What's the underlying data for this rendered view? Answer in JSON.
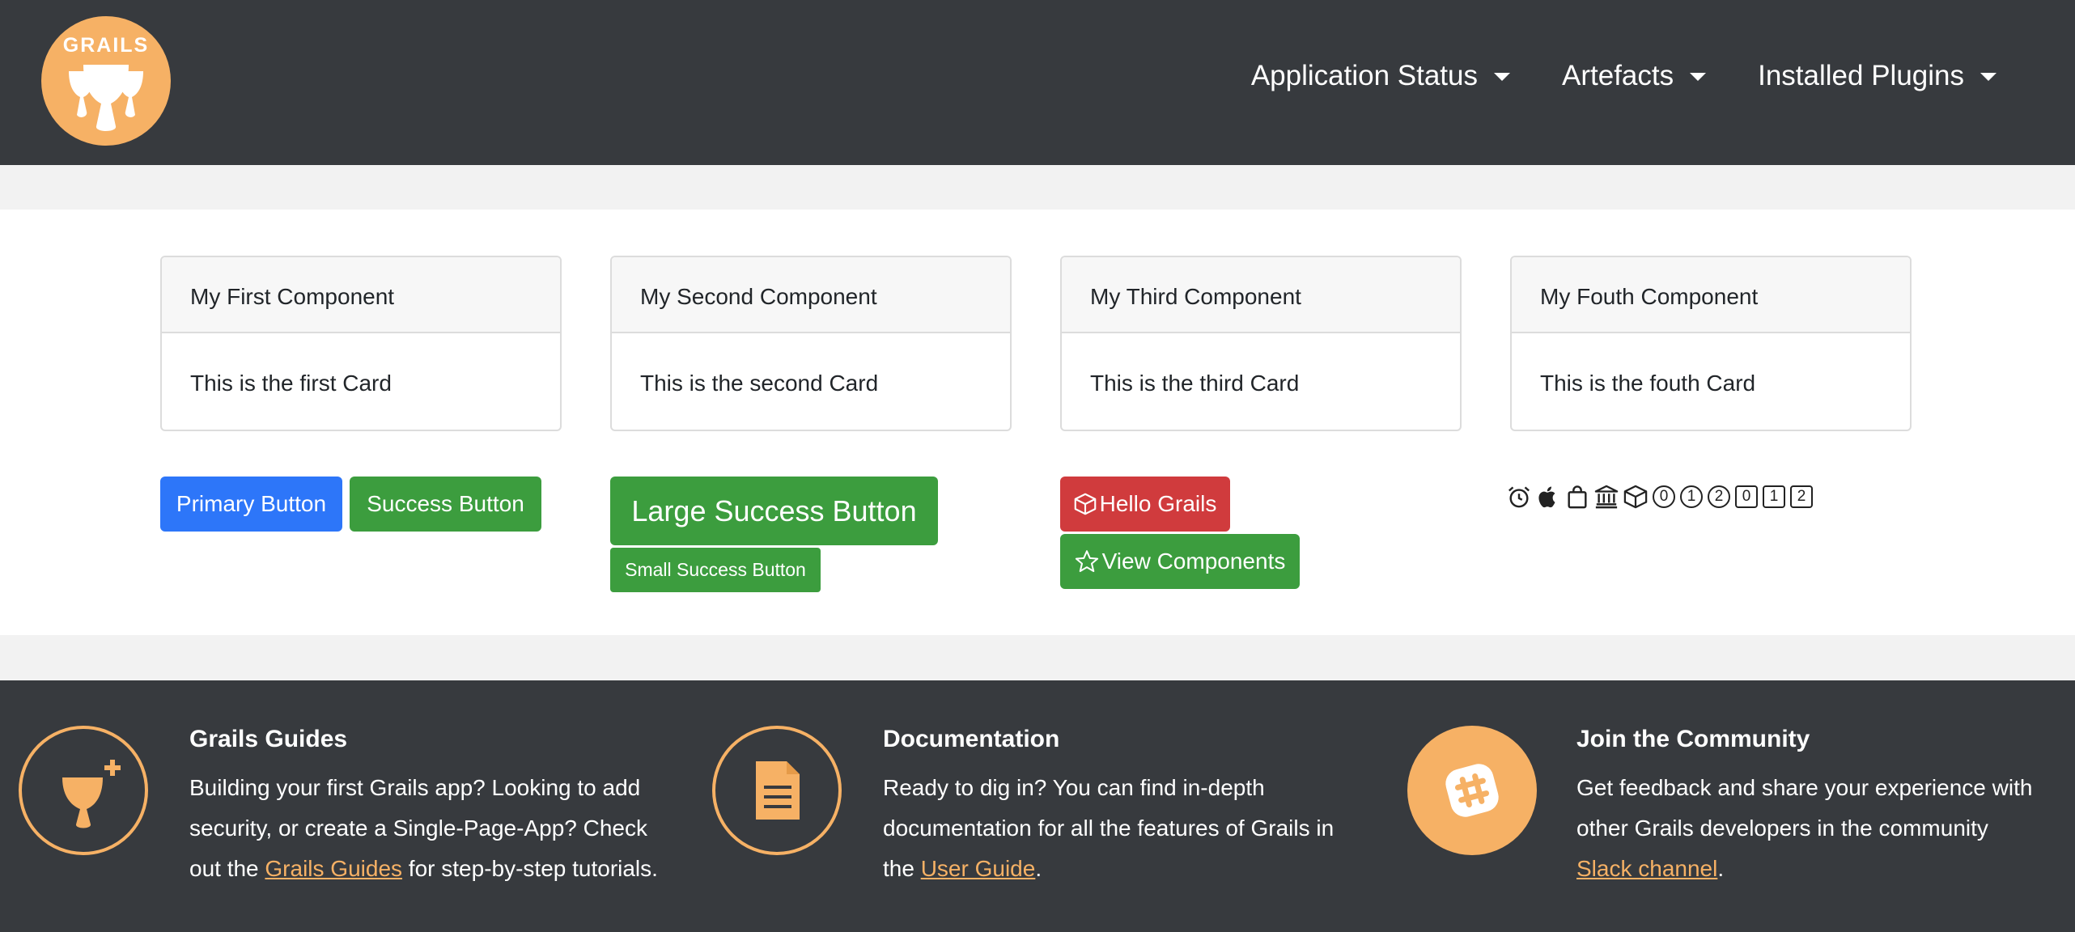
{
  "header": {
    "logo_text": "GRAILS",
    "nav": [
      {
        "label": "Application Status"
      },
      {
        "label": "Artefacts"
      },
      {
        "label": "Installed Plugins"
      }
    ]
  },
  "cards": [
    {
      "title": "My First Component",
      "body": "This is the first Card"
    },
    {
      "title": "My Second Component",
      "body": "This is the second Card"
    },
    {
      "title": "My Third Component",
      "body": "This is the third Card"
    },
    {
      "title": "My Fouth Component",
      "body": "This is the fouth Card"
    }
  ],
  "buttons": {
    "primary": "Primary Button",
    "success": "Success Button",
    "large_success": "Large Success Button",
    "small_success": "Small Success Button",
    "hello": "Hello Grails",
    "view_components": "View Components"
  },
  "icon_row": {
    "icons": [
      "alarm-clock-icon",
      "apple-icon",
      "bag-icon",
      "bank-icon",
      "box-icon"
    ],
    "circled_numbers": [
      "0",
      "1",
      "2"
    ],
    "squared_numbers": [
      "0",
      "1",
      "2"
    ]
  },
  "footer": {
    "guides": {
      "title": "Grails Guides",
      "text_before": "Building your first Grails app? Looking to add security, or create a Single-Page-App? Check out the ",
      "link": "Grails Guides",
      "text_after": " for step-by-step tutorials."
    },
    "docs": {
      "title": "Documentation",
      "text_before": "Ready to dig in? You can find in-depth documentation for all the features of Grails in the ",
      "link": "User Guide",
      "text_after": "."
    },
    "community": {
      "title": "Join the Community",
      "text_before": "Get feedback and share your experience with other Grails developers in the community ",
      "link": "Slack channel",
      "text_after": "."
    }
  },
  "colors": {
    "brand": "#f6b165",
    "header_bg": "#373a3e",
    "primary": "#2d76f9",
    "success": "#3c9d3e",
    "danger": "#d03b3d"
  }
}
